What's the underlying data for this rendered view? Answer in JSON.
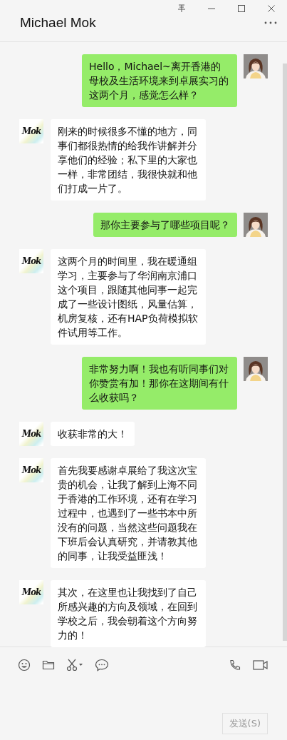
{
  "window": {
    "title": "Michael Mok"
  },
  "messages": [
    {
      "kind": "outgoing",
      "text": "Hello，Michael~离开香港的母校及生活环境来到卓展实习的这两个月，感觉怎么样？"
    },
    {
      "kind": "incoming",
      "avatar_text": "Mok",
      "text": "刚来的时候很多不懂的地方，同事们都很热情的给我作讲解并分享他们的经验；私下里的大家也一样，非常团结，我很快就和他们打成一片了。"
    },
    {
      "kind": "outgoing",
      "text": "那你主要参与了哪些项目呢？"
    },
    {
      "kind": "incoming",
      "avatar_text": "Mok",
      "text": "这两个月的时间里，我在暖通组学习，主要参与了华润南京浦口这个项目，跟随其他同事一起完成了一些设计图纸，风量估算，机房复核，还有HAP负荷模拟软件试用等工作。"
    },
    {
      "kind": "outgoing",
      "text": "非常努力啊！我也有听同事们对你赞赏有加！那你在这期间有什么收获吗？"
    },
    {
      "kind": "incoming",
      "avatar_text": "Mok",
      "text": "收获非常的大！"
    },
    {
      "kind": "incoming",
      "avatar_text": "Mok",
      "text": "首先我要感谢卓展给了我这次宝贵的机会，让我了解到上海不同于香港的工作环境，还有在学习过程中，也遇到了一些书本中所没有的问题，当然这些问题我在下班后会认真研究，并请教其他的同事，让我受益匪浅！"
    },
    {
      "kind": "incoming",
      "avatar_text": "Mok",
      "text": "其次，在这里也让我找到了自己所感兴趣的方向及领域，在回到学校之后，我会朝着这个方向努力的！"
    }
  ],
  "composer": {
    "send_button": "发送(S)"
  }
}
